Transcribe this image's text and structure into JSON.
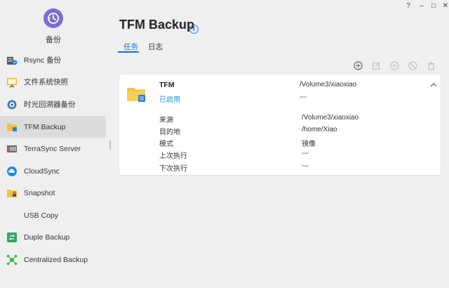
{
  "app": {
    "title": "备份",
    "accent": "#7d6cd8"
  },
  "window_controls": {
    "help": "?",
    "minimize": "–",
    "maximize": "□",
    "close": "✕"
  },
  "sidebar": {
    "items": [
      {
        "label": "Rsync 备份",
        "icon": "server-sync-icon"
      },
      {
        "label": "文件系统快照",
        "icon": "snapshot-monitor-icon"
      },
      {
        "label": "时光回溯器备份",
        "icon": "time-machine-icon"
      },
      {
        "label": "TFM Backup",
        "icon": "folder-icon",
        "active": true
      },
      {
        "label": "TerraSync Server",
        "icon": "nas-icon"
      },
      {
        "label": "CloudSync",
        "icon": "cloud-icon"
      },
      {
        "label": "Snapshot",
        "icon": "folder-lock-icon"
      },
      {
        "label": "USB Copy",
        "icon": "usb-icon"
      },
      {
        "label": "Duple Backup",
        "icon": "duplicate-icon"
      },
      {
        "label": "Centralized Backup",
        "icon": "network-icon"
      }
    ]
  },
  "main": {
    "title": "TFM Backup",
    "tabs": [
      {
        "label": "任务",
        "active": true
      },
      {
        "label": "日志",
        "active": false
      }
    ],
    "toolbar": [
      "add-icon",
      "edit-icon",
      "pause-icon",
      "disable-icon",
      "delete-icon"
    ],
    "job": {
      "name": "TFM",
      "status": "已启用",
      "path": "/Volume3/xiaoxiao",
      "path_sub": "---",
      "details": [
        {
          "label": "来源",
          "value": "/Volume3/xiaoxiao"
        },
        {
          "label": "目的地",
          "value": "/home/Xiao"
        },
        {
          "label": "模式",
          "value": "镜像"
        },
        {
          "label": "上次执行",
          "value": "---"
        },
        {
          "label": "下次执行",
          "value": "---"
        }
      ]
    }
  },
  "colors": {
    "active_tab": "#1a6fc4",
    "status_enabled": "#1a8fd8",
    "folder": "#f5c13c"
  }
}
